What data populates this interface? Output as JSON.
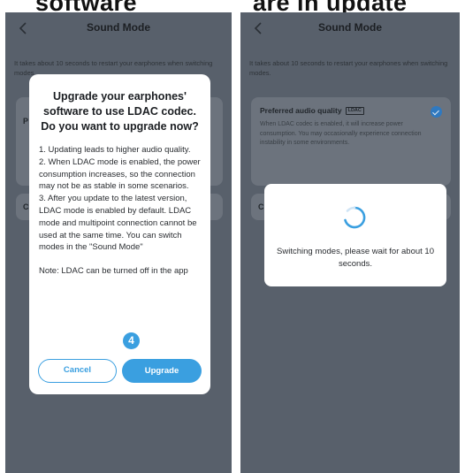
{
  "captions": {
    "left": "software",
    "right": "are in update"
  },
  "left_screen": {
    "nav_title": "Sound Mode",
    "hint": "It takes about 10 seconds to restart your earphones when switching modes.",
    "peek_first": "P",
    "peek_second": "C",
    "dialog": {
      "title": "Upgrade your earphones' software to use LDAC codec. Do you want to upgrade now?",
      "items": [
        "1. Updating leads to higher audio quality.",
        "2. When LDAC mode is enabled, the power consumption increases, so the connection may not be as stable in some scenarios.",
        "3. After you update to the latest version, LDAC mode is enabled by default. LDAC mode and multipoint connection cannot be used at the same time. You can switch modes in the \"Sound Mode\""
      ],
      "note": "Note: LDAC can be turned off in the app",
      "step_number": "4",
      "cancel_label": "Cancel",
      "upgrade_label": "Upgrade"
    }
  },
  "right_screen": {
    "nav_title": "Sound Mode",
    "hint": "It takes about 10 seconds to restart your earphones when switching modes.",
    "card": {
      "title": "Preferred audio quality",
      "badge": "LDAC",
      "description": "When LDAC codec is enabled, it will increase power consumption. You may occasionally experience connection instability in some environments."
    },
    "peek_second": "C",
    "switch_modal": {
      "message": "Switching modes, please wait for about 10 seconds."
    }
  },
  "colors": {
    "accent": "#3a9fe0",
    "overlay": "#58606b",
    "dialog_bg": "#ffffff"
  }
}
